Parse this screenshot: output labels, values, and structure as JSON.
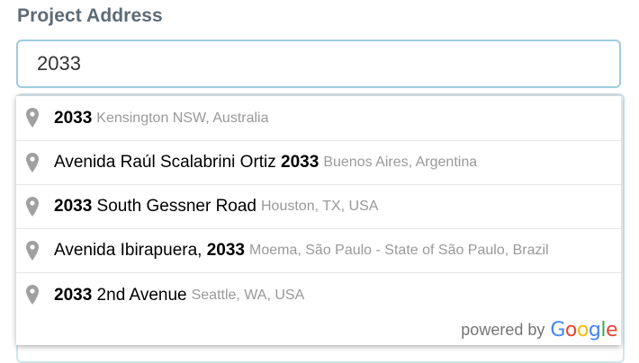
{
  "form": {
    "label": "Project Address",
    "input_value": "2033"
  },
  "suggestions": [
    {
      "pre": "",
      "match": "2033",
      "post": "",
      "secondary": "Kensington NSW, Australia",
      "icon": "map-pin-icon"
    },
    {
      "pre": "Avenida Raúl Scalabrini Ortiz ",
      "match": "2033",
      "post": "",
      "secondary": "Buenos Aires, Argentina",
      "icon": "map-pin-icon"
    },
    {
      "pre": "",
      "match": "2033",
      "post": " South Gessner Road",
      "secondary": "Houston, TX, USA",
      "icon": "map-pin-icon"
    },
    {
      "pre": "Avenida Ibirapuera, ",
      "match": "2033",
      "post": "",
      "secondary": "Moema, São Paulo - State of São Paulo, Brazil",
      "icon": "map-pin-icon"
    },
    {
      "pre": "",
      "match": "2033",
      "post": " 2nd Avenue",
      "secondary": "Seattle, WA, USA",
      "icon": "map-pin-icon"
    }
  ],
  "attribution": {
    "powered_by": "powered by",
    "brand_letters": [
      "G",
      "o",
      "o",
      "g",
      "l",
      "e"
    ]
  },
  "colors": {
    "input_border": "#9ecde0",
    "label": "#5d6b77",
    "secondary_text": "#999999",
    "pin": "#a0a0a0"
  }
}
